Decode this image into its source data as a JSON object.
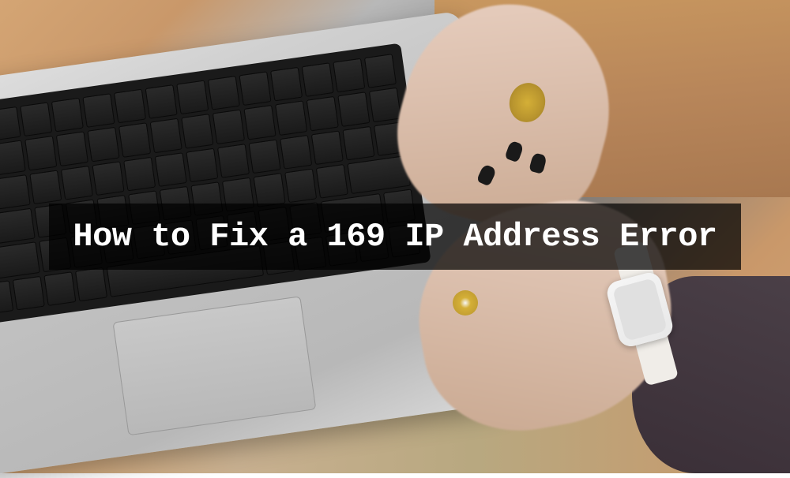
{
  "overlay": {
    "title": "How to Fix a 169 IP Address Error",
    "background_color": "rgba(0, 0, 0, 0.72)",
    "text_color": "#ffffff"
  }
}
